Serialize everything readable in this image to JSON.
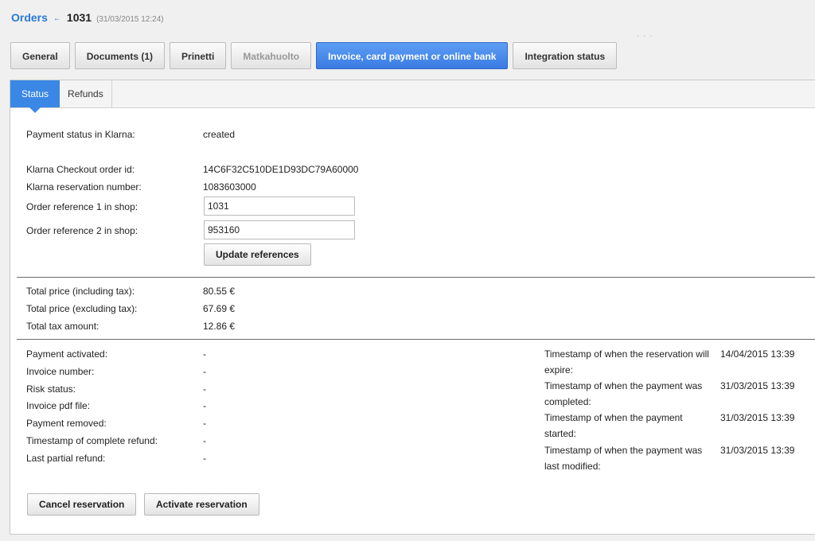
{
  "breadcrumb": {
    "link": "Orders",
    "sep": "←",
    "title": "1031",
    "date": "(31/03/2015 12:24)"
  },
  "tabs": [
    {
      "label": "General"
    },
    {
      "label": "Documents (1)"
    },
    {
      "label": "Prinetti"
    },
    {
      "label": "Matkahuolto"
    },
    {
      "label": "Invoice, card payment or online bank"
    },
    {
      "label": "Integration status"
    }
  ],
  "tabs_dots": "· · ·",
  "subtabs": [
    {
      "label": "Status"
    },
    {
      "label": "Refunds"
    }
  ],
  "status": {
    "payment_status_label": "Payment status in Klarna:",
    "payment_status_value": "created",
    "checkout_id_label": "Klarna Checkout order id:",
    "checkout_id_value": "14C6F32C510DE1D93DC79A60000",
    "reservation_label": "Klarna reservation number:",
    "reservation_value": "1083603000",
    "ref1_label": "Order reference 1 in shop:",
    "ref1_value": "1031",
    "ref2_label": "Order reference 2 in shop:",
    "ref2_value": "953160",
    "update_button": "Update references"
  },
  "totals": {
    "incl_label": "Total price (including tax):",
    "incl_value": "80.55 €",
    "excl_label": "Total price (excluding tax):",
    "excl_value": "67.69 €",
    "tax_label": "Total tax amount:",
    "tax_value": "12.86 €"
  },
  "details_left": [
    {
      "label": "Payment activated:",
      "value": "-"
    },
    {
      "label": "Invoice number:",
      "value": "-"
    },
    {
      "label": "Risk status:",
      "value": "-"
    },
    {
      "label": "Invoice pdf file:",
      "value": "-"
    },
    {
      "label": "Payment removed:",
      "value": "-"
    },
    {
      "label": "Timestamp of complete refund:",
      "value": "-"
    },
    {
      "label": "Last partial refund:",
      "value": "-"
    }
  ],
  "details_right": [
    {
      "label": "Timestamp of when the reservation will expire:",
      "value": "14/04/2015 13:39"
    },
    {
      "label": "Timestamp of when the payment was completed:",
      "value": "31/03/2015 13:39"
    },
    {
      "label": "Timestamp of when the payment started:",
      "value": "31/03/2015 13:39"
    },
    {
      "label": "Timestamp of when the payment was last modified:",
      "value": "31/03/2015 13:39"
    }
  ],
  "actions": {
    "cancel": "Cancel reservation",
    "activate": "Activate reservation"
  }
}
